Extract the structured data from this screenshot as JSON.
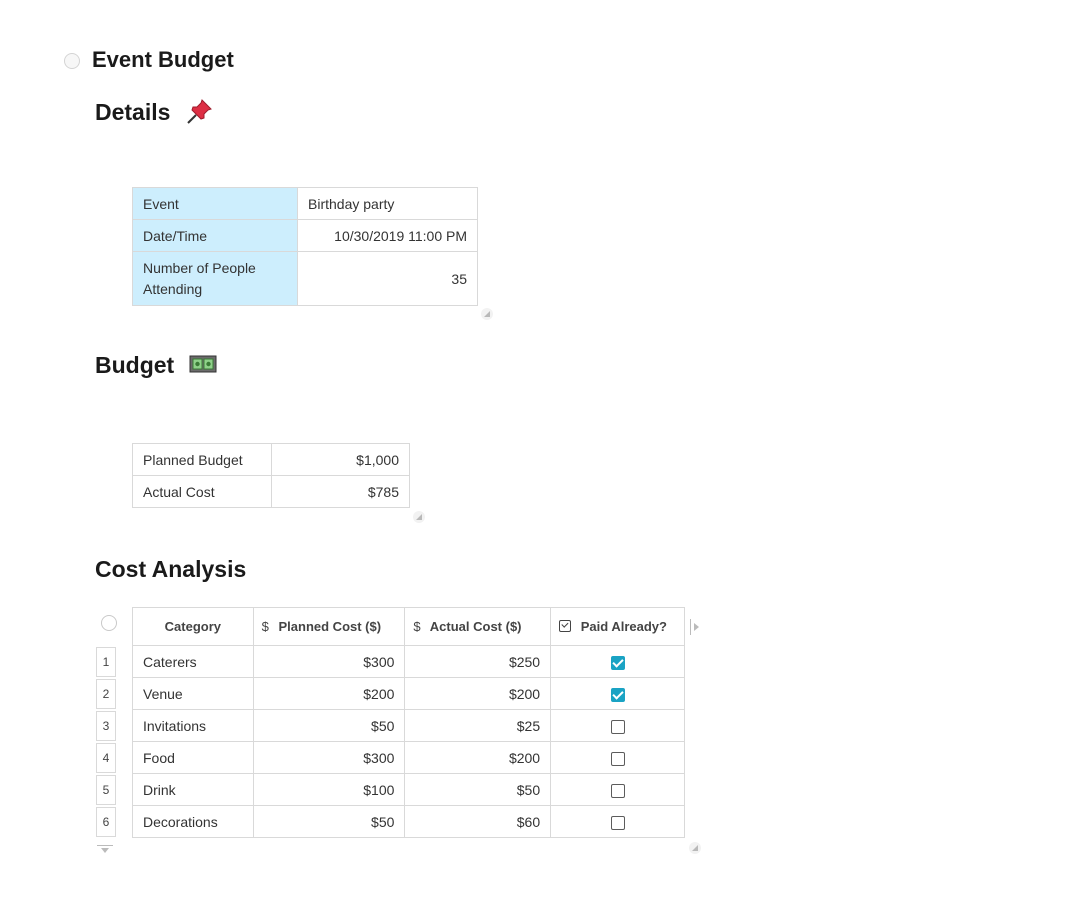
{
  "doc": {
    "title": "Event Budget"
  },
  "details": {
    "heading": "Details",
    "rows": [
      {
        "label": "Event",
        "value": "Birthday party"
      },
      {
        "label": "Date/Time",
        "value": "10/30/2019 11:00 PM"
      },
      {
        "label": "Number of People Attending",
        "value": "35"
      }
    ]
  },
  "budget": {
    "heading": "Budget",
    "rows": [
      {
        "label": "Planned Budget",
        "value": "$1,000"
      },
      {
        "label": "Actual Cost",
        "value": "$785"
      }
    ]
  },
  "cost_analysis": {
    "heading": "Cost Analysis",
    "columns": {
      "category": "Category",
      "planned": "Planned Cost ($)",
      "actual": "Actual Cost ($)",
      "paid": "Paid Already?",
      "currency_icon": "$"
    },
    "rows": [
      {
        "num": "1",
        "category": "Caterers",
        "planned": "$300",
        "actual": "$250",
        "paid": true
      },
      {
        "num": "2",
        "category": "Venue",
        "planned": "$200",
        "actual": "$200",
        "paid": true
      },
      {
        "num": "3",
        "category": "Invitations",
        "planned": "$50",
        "actual": "$25",
        "paid": false
      },
      {
        "num": "4",
        "category": "Food",
        "planned": "$300",
        "actual": "$200",
        "paid": false
      },
      {
        "num": "5",
        "category": "Drink",
        "planned": "$100",
        "actual": "$50",
        "paid": false
      },
      {
        "num": "6",
        "category": "Decorations",
        "planned": "$50",
        "actual": "$60",
        "paid": false
      }
    ]
  },
  "icons": {
    "pushpin": "pushpin-icon",
    "money": "dollar-banknote-icon"
  },
  "colors": {
    "accent": "#1aa3c4",
    "label_bg": "#cdeefd"
  }
}
